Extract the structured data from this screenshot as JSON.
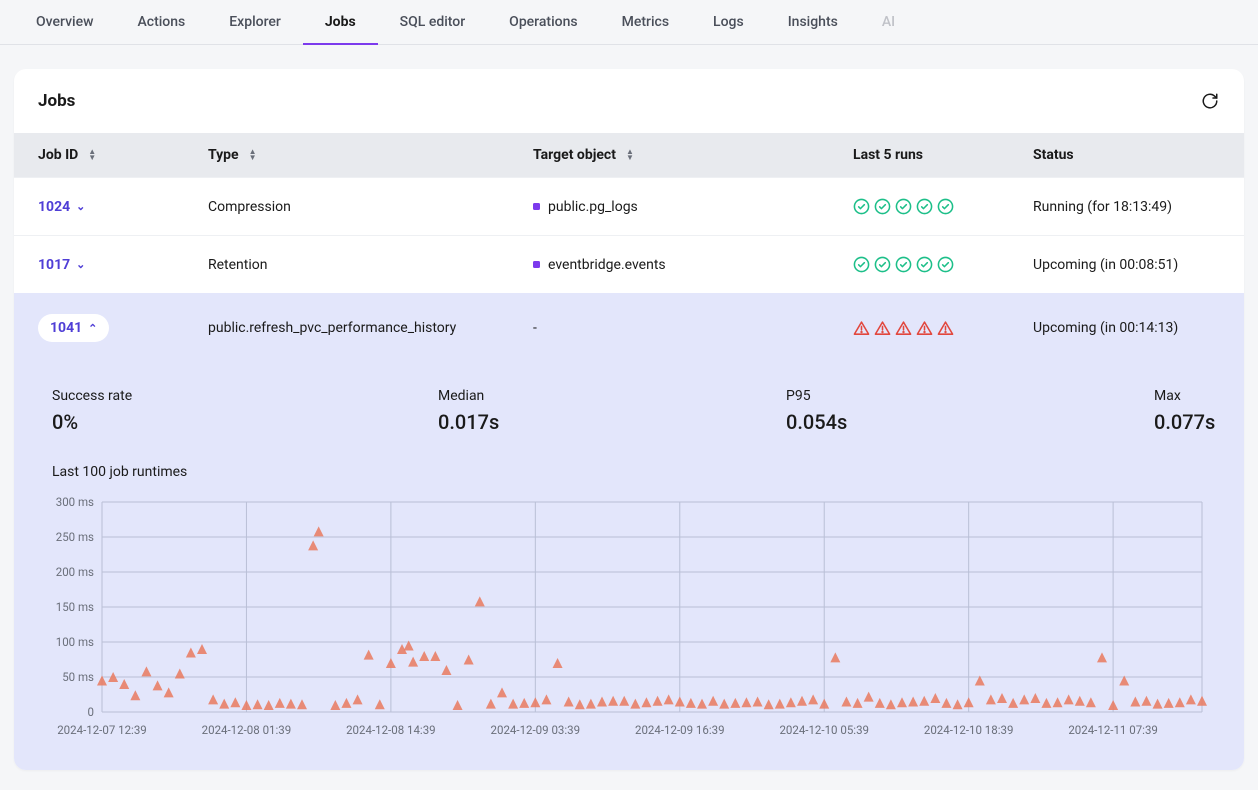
{
  "tabs": [
    "Overview",
    "Actions",
    "Explorer",
    "Jobs",
    "SQL editor",
    "Operations",
    "Metrics",
    "Logs",
    "Insights",
    "AI"
  ],
  "active_tab": "Jobs",
  "disabled_tab": "AI",
  "card": {
    "title": "Jobs"
  },
  "columns": [
    "Job ID",
    "Type",
    "Target object",
    "Last 5 runs",
    "Status"
  ],
  "rows": [
    {
      "id": "1024",
      "type": "Compression",
      "target": "public.pg_logs",
      "show_dot": true,
      "runs": [
        "ok",
        "ok",
        "ok",
        "ok",
        "ok"
      ],
      "status": "Running (for 18:13:49)",
      "expanded": false
    },
    {
      "id": "1017",
      "type": "Retention",
      "target": "eventbridge.events",
      "show_dot": true,
      "runs": [
        "ok",
        "ok",
        "ok",
        "ok",
        "ok"
      ],
      "status": "Upcoming (in 00:08:51)",
      "expanded": false
    },
    {
      "id": "1041",
      "type": "public.refresh_pvc_performance_history",
      "target": "-",
      "show_dot": false,
      "runs": [
        "warn",
        "warn",
        "warn",
        "warn",
        "warn"
      ],
      "status": "Upcoming (in 00:14:13)",
      "expanded": true
    }
  ],
  "panel": {
    "stats": [
      {
        "label": "Success rate",
        "value": "0%"
      },
      {
        "label": "Median",
        "value": "0.017s"
      },
      {
        "label": "P95",
        "value": "0.054s"
      },
      {
        "label": "Max",
        "value": "0.077s"
      }
    ]
  },
  "chart_data": {
    "type": "scatter",
    "title": "Last 100 job runtimes",
    "xlabel": "",
    "ylabel": "",
    "ylim": [
      0,
      300
    ],
    "yticks": [
      0,
      50,
      100,
      150,
      200,
      250,
      300
    ],
    "ytick_labels": [
      "0",
      "50 ms",
      "100 ms",
      "150 ms",
      "200 ms",
      "250 ms",
      "300 ms"
    ],
    "x_range": [
      0,
      99
    ],
    "xtick_labels": [
      "2024-12-07 12:39",
      "2024-12-08 01:39",
      "2024-12-08 14:39",
      "2024-12-09 03:39",
      "2024-12-09 16:39",
      "2024-12-10 05:39",
      "2024-12-10 18:39",
      "2024-12-11 07:39"
    ],
    "xtick_positions": [
      0,
      13,
      26,
      39,
      52,
      65,
      78,
      91
    ],
    "series": [
      {
        "name": "runtimes_ms",
        "marker": "triangle",
        "color": "#e9795e",
        "x": [
          0,
          1,
          2,
          3,
          4,
          5,
          6,
          7,
          8,
          9,
          10,
          11,
          12,
          13,
          14,
          15,
          16,
          17,
          18,
          19,
          19.5,
          21,
          22,
          23,
          24,
          25,
          26,
          27,
          27.6,
          28,
          29,
          30,
          31,
          32,
          33,
          34,
          35,
          36,
          37,
          38,
          39,
          40,
          41,
          42,
          43,
          44,
          45,
          46,
          47,
          48,
          49,
          50,
          51,
          52,
          53,
          54,
          55,
          56,
          57,
          58,
          59,
          60,
          61,
          62,
          63,
          64,
          65,
          66,
          67,
          68,
          69,
          70,
          71,
          72,
          73,
          74,
          75,
          76,
          77,
          78,
          79,
          80,
          81,
          82,
          83,
          84,
          85,
          86,
          87,
          88,
          89,
          90,
          91,
          92,
          93,
          94,
          95,
          96,
          97,
          98,
          99
        ],
        "values": [
          45,
          50,
          40,
          24,
          58,
          38,
          28,
          55,
          85,
          90,
          18,
          12,
          14,
          10,
          11,
          10,
          13,
          12,
          11,
          238,
          258,
          10,
          13,
          18,
          82,
          11,
          70,
          90,
          95,
          72,
          80,
          80,
          60,
          10,
          75,
          158,
          12,
          28,
          12,
          13,
          14,
          18,
          70,
          15,
          11,
          12,
          15,
          16,
          16,
          12,
          14,
          16,
          18,
          15,
          13,
          12,
          16,
          12,
          13,
          14,
          15,
          11,
          12,
          14,
          16,
          18,
          12,
          78,
          15,
          13,
          22,
          13,
          11,
          14,
          15,
          16,
          20,
          13,
          11,
          14,
          45,
          18,
          20,
          13,
          18,
          20,
          13,
          14,
          18,
          16,
          14,
          78,
          10,
          45,
          15,
          16,
          12,
          13,
          14,
          18,
          16,
          15
        ]
      }
    ]
  }
}
